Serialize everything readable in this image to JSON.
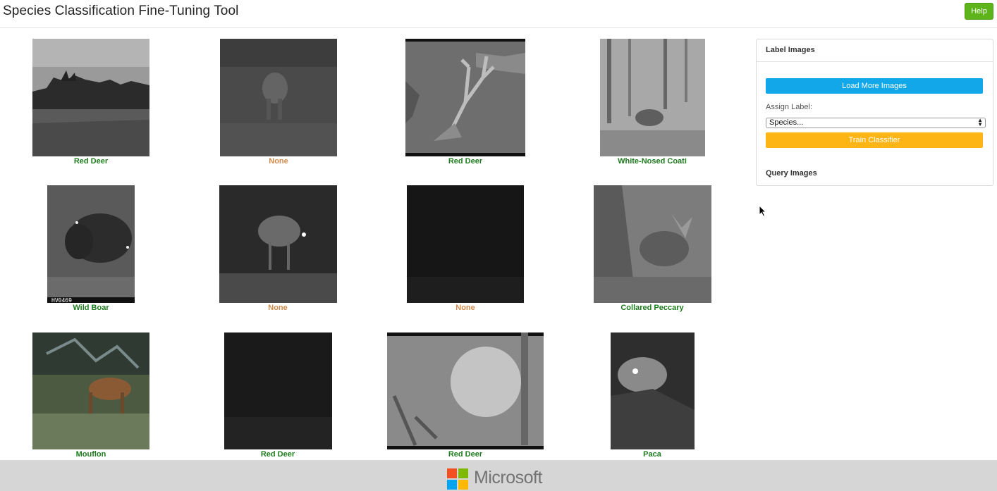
{
  "header": {
    "title": "Species Classification Fine-Tuning Tool",
    "help_label": "Help"
  },
  "images": [
    {
      "label": "Red Deer",
      "status": "labeled"
    },
    {
      "label": "None",
      "status": "unlabeled"
    },
    {
      "label": "Red Deer",
      "status": "labeled"
    },
    {
      "label": "White-Nosed Coati",
      "status": "labeled"
    },
    {
      "label": "Wild Boar",
      "status": "labeled",
      "overlay_text": "HV0469"
    },
    {
      "label": "None",
      "status": "unlabeled"
    },
    {
      "label": "None",
      "status": "unlabeled"
    },
    {
      "label": "Collared Peccary",
      "status": "labeled"
    },
    {
      "label": "Mouflon",
      "status": "labeled"
    },
    {
      "label": "Red Deer",
      "status": "labeled"
    },
    {
      "label": "Red Deer",
      "status": "labeled"
    },
    {
      "label": "Paca",
      "status": "labeled"
    }
  ],
  "panel": {
    "label_images_title": "Label Images",
    "load_more_label": "Load More Images",
    "assign_label_text": "Assign Label:",
    "species_select_value": "Species...",
    "train_classifier_label": "Train Classifier",
    "query_images_title": "Query Images"
  },
  "footer": {
    "brand": "Microsoft"
  },
  "colors": {
    "labeled": "#1e7b1e",
    "unlabeled": "#d08a4a",
    "help_button": "#5cb31a",
    "load_more_button": "#11a7e8",
    "train_button": "#fdb515",
    "footer_bg": "#d6d6d6"
  }
}
